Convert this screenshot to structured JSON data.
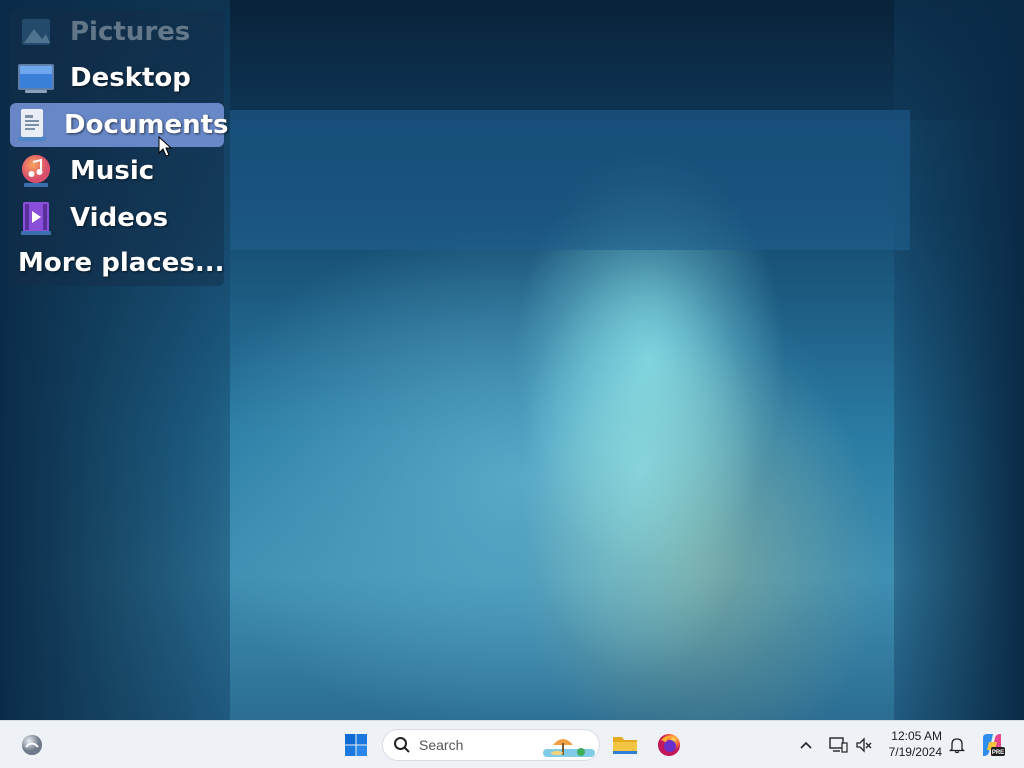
{
  "places": {
    "items": [
      {
        "label": "Pictures",
        "icon": "pictures-icon"
      },
      {
        "label": "Desktop",
        "icon": "desktop-icon"
      },
      {
        "label": "Documents",
        "icon": "documents-icon"
      },
      {
        "label": "Music",
        "icon": "music-icon"
      },
      {
        "label": "Videos",
        "icon": "videos-icon"
      }
    ],
    "more_label": "More places...",
    "selected": "Documents"
  },
  "taskbar": {
    "search_placeholder": "Search",
    "time": "12:05 AM",
    "date": "7/19/2024",
    "pinned": [
      "start-icon",
      "file-explorer-icon",
      "firefox-icon"
    ],
    "copilot_badge": "PRE"
  },
  "colors": {
    "selection": "#7896dc",
    "taskbar_bg": "#eef1f6",
    "start_blue": "#0f6cd4",
    "folder_yellow": "#f4c542",
    "firefox_orange": "#ff7139"
  }
}
